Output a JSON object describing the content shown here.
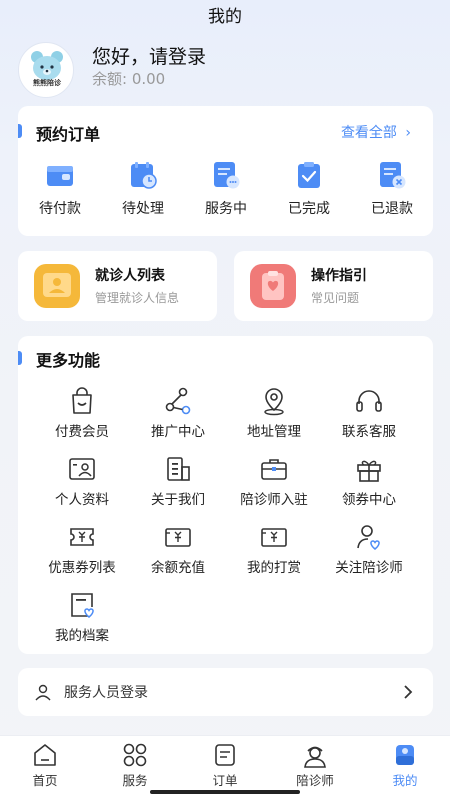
{
  "header": {
    "title": "我的"
  },
  "profile": {
    "greeting": "您好，请登录",
    "balance_text": "余额: 0.00",
    "avatar_brand": "熊熊陪诊"
  },
  "orders": {
    "title": "预约订单",
    "view_all": "查看全部",
    "items": [
      {
        "label": "待付款",
        "icon": "wallet-icon"
      },
      {
        "label": "待处理",
        "icon": "clock-calendar-icon"
      },
      {
        "label": "服务中",
        "icon": "document-chat-icon"
      },
      {
        "label": "已完成",
        "icon": "clipboard-check-icon"
      },
      {
        "label": "已退款",
        "icon": "document-cancel-icon"
      }
    ]
  },
  "quick_cards": [
    {
      "title": "就诊人列表",
      "subtitle": "管理就诊人信息",
      "icon": "patient-list-icon",
      "color": "#f5b83a"
    },
    {
      "title": "操作指引",
      "subtitle": "常见问题",
      "icon": "guide-icon",
      "color": "#f07a78"
    }
  ],
  "more": {
    "title": "更多功能",
    "items": [
      {
        "label": "付费会员",
        "icon": "shopping-bag-icon"
      },
      {
        "label": "推广中心",
        "icon": "share-icon"
      },
      {
        "label": "地址管理",
        "icon": "location-icon"
      },
      {
        "label": "联系客服",
        "icon": "headset-icon"
      },
      {
        "label": "个人资料",
        "icon": "id-card-icon"
      },
      {
        "label": "关于我们",
        "icon": "building-icon"
      },
      {
        "label": "陪诊师入驻",
        "icon": "briefcase-icon"
      },
      {
        "label": "领券中心",
        "icon": "gift-icon"
      },
      {
        "label": "优惠券列表",
        "icon": "ticket-icon"
      },
      {
        "label": "余额充值",
        "icon": "recharge-icon"
      },
      {
        "label": "我的打赏",
        "icon": "reward-icon"
      },
      {
        "label": "关注陪诊师",
        "icon": "follow-user-icon"
      },
      {
        "label": "我的档案",
        "icon": "archive-icon"
      }
    ]
  },
  "staff_login": {
    "label": "服务人员登录",
    "icon": "user-icon"
  },
  "tabbar": {
    "items": [
      {
        "label": "首页",
        "icon": "home-icon",
        "active": false
      },
      {
        "label": "服务",
        "icon": "grid-icon",
        "active": false
      },
      {
        "label": "订单",
        "icon": "order-icon",
        "active": false
      },
      {
        "label": "陪诊师",
        "icon": "nurse-icon",
        "active": false
      },
      {
        "label": "我的",
        "icon": "profile-icon",
        "active": true
      }
    ]
  },
  "colors": {
    "accent": "#4d8cf5",
    "yellow": "#f5b83a",
    "red": "#f07a78"
  }
}
